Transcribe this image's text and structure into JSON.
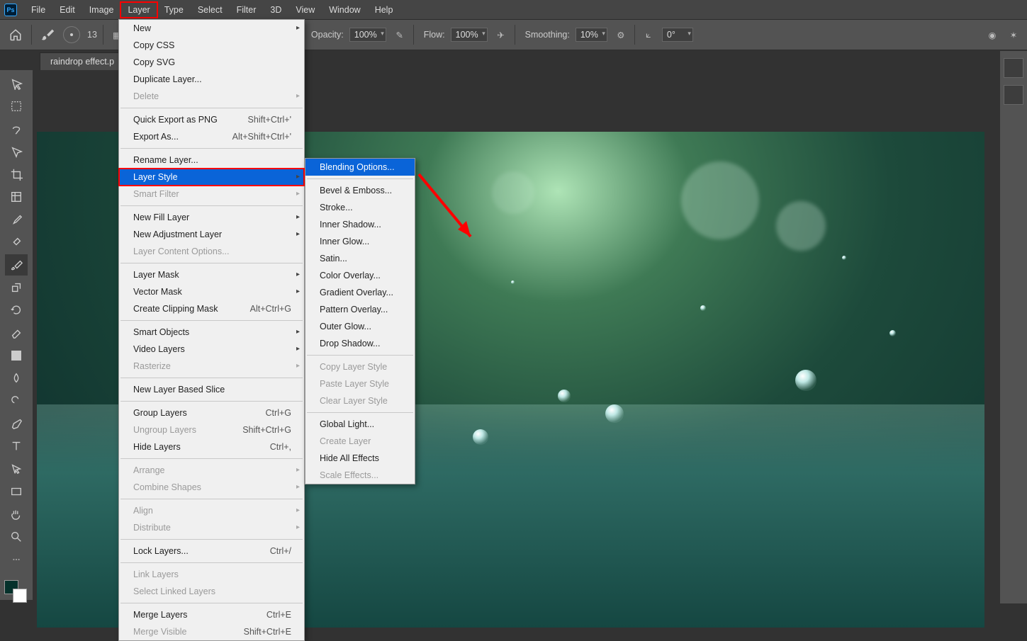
{
  "menubar": {
    "items": [
      "File",
      "Edit",
      "Image",
      "Layer",
      "Type",
      "Select",
      "Filter",
      "3D",
      "View",
      "Window",
      "Help"
    ],
    "highlighted": "Layer"
  },
  "options": {
    "brush_size": "13",
    "opacity_label": "Opacity:",
    "opacity_value": "100%",
    "flow_label": "Flow:",
    "flow_value": "100%",
    "smoothing_label": "Smoothing:",
    "smoothing_value": "10%",
    "angle_value": "0°"
  },
  "doc_tab": "raindrop effect.p",
  "layer_menu": [
    {
      "label": "New",
      "arrow": true
    },
    {
      "label": "Copy CSS"
    },
    {
      "label": "Copy SVG"
    },
    {
      "label": "Duplicate Layer..."
    },
    {
      "label": "Delete",
      "arrow": true,
      "disabled": true
    },
    {
      "sep": true
    },
    {
      "label": "Quick Export as PNG",
      "shortcut": "Shift+Ctrl+'"
    },
    {
      "label": "Export As...",
      "shortcut": "Alt+Shift+Ctrl+'"
    },
    {
      "sep": true
    },
    {
      "label": "Rename Layer..."
    },
    {
      "label": "Layer Style",
      "arrow": true,
      "selected": true,
      "redbox": true
    },
    {
      "label": "Smart Filter",
      "arrow": true,
      "disabled": true
    },
    {
      "sep": true
    },
    {
      "label": "New Fill Layer",
      "arrow": true
    },
    {
      "label": "New Adjustment Layer",
      "arrow": true
    },
    {
      "label": "Layer Content Options...",
      "disabled": true
    },
    {
      "sep": true
    },
    {
      "label": "Layer Mask",
      "arrow": true
    },
    {
      "label": "Vector Mask",
      "arrow": true
    },
    {
      "label": "Create Clipping Mask",
      "shortcut": "Alt+Ctrl+G"
    },
    {
      "sep": true
    },
    {
      "label": "Smart Objects",
      "arrow": true
    },
    {
      "label": "Video Layers",
      "arrow": true
    },
    {
      "label": "Rasterize",
      "arrow": true,
      "disabled": true
    },
    {
      "sep": true
    },
    {
      "label": "New Layer Based Slice"
    },
    {
      "sep": true
    },
    {
      "label": "Group Layers",
      "shortcut": "Ctrl+G"
    },
    {
      "label": "Ungroup Layers",
      "shortcut": "Shift+Ctrl+G",
      "disabled": true
    },
    {
      "label": "Hide Layers",
      "shortcut": "Ctrl+,"
    },
    {
      "sep": true
    },
    {
      "label": "Arrange",
      "arrow": true,
      "disabled": true
    },
    {
      "label": "Combine Shapes",
      "arrow": true,
      "disabled": true
    },
    {
      "sep": true
    },
    {
      "label": "Align",
      "arrow": true,
      "disabled": true
    },
    {
      "label": "Distribute",
      "arrow": true,
      "disabled": true
    },
    {
      "sep": true
    },
    {
      "label": "Lock Layers...",
      "shortcut": "Ctrl+/"
    },
    {
      "sep": true
    },
    {
      "label": "Link Layers",
      "disabled": true
    },
    {
      "label": "Select Linked Layers",
      "disabled": true
    },
    {
      "sep": true
    },
    {
      "label": "Merge Layers",
      "shortcut": "Ctrl+E"
    },
    {
      "label": "Merge Visible",
      "shortcut": "Shift+Ctrl+E",
      "disabled": true
    }
  ],
  "style_menu": [
    {
      "label": "Blending Options...",
      "selected": true
    },
    {
      "sep": true
    },
    {
      "label": "Bevel & Emboss..."
    },
    {
      "label": "Stroke..."
    },
    {
      "label": "Inner Shadow..."
    },
    {
      "label": "Inner Glow..."
    },
    {
      "label": "Satin..."
    },
    {
      "label": "Color Overlay..."
    },
    {
      "label": "Gradient Overlay..."
    },
    {
      "label": "Pattern Overlay..."
    },
    {
      "label": "Outer Glow..."
    },
    {
      "label": "Drop Shadow..."
    },
    {
      "sep": true
    },
    {
      "label": "Copy Layer Style",
      "disabled": true
    },
    {
      "label": "Paste Layer Style",
      "disabled": true
    },
    {
      "label": "Clear Layer Style",
      "disabled": true
    },
    {
      "sep": true
    },
    {
      "label": "Global Light..."
    },
    {
      "label": "Create Layer",
      "disabled": true
    },
    {
      "label": "Hide All Effects"
    },
    {
      "label": "Scale Effects...",
      "disabled": true
    }
  ],
  "tools": [
    "move",
    "marquee",
    "lasso",
    "quick-select",
    "crop",
    "frame",
    "eyedropper",
    "healing",
    "brush",
    "clone",
    "history-brush",
    "eraser",
    "gradient",
    "blur",
    "dodge",
    "pen",
    "type",
    "path-select",
    "rectangle",
    "hand",
    "zoom",
    "more"
  ]
}
